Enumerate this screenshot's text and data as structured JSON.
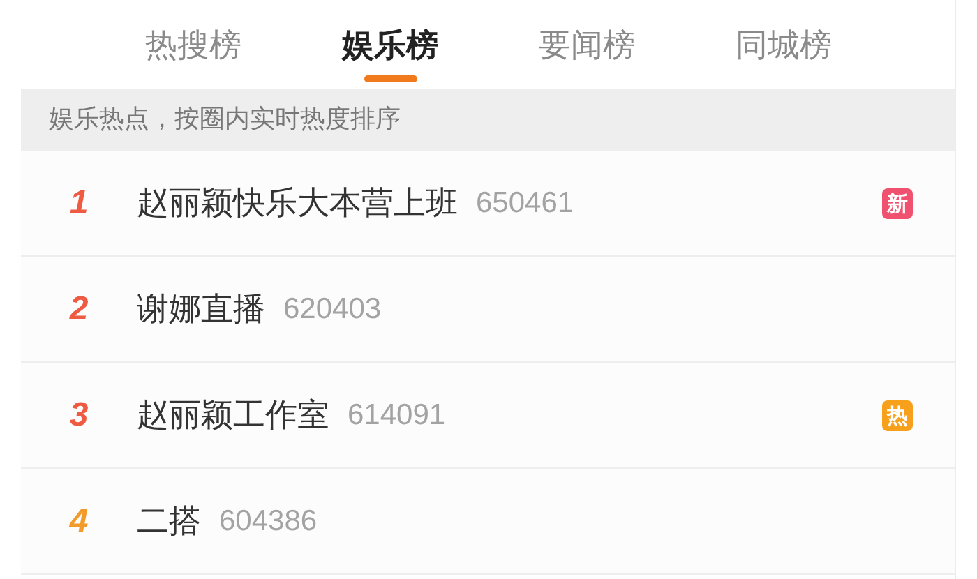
{
  "tabs": [
    {
      "label": "热搜榜",
      "selected": false
    },
    {
      "label": "娱乐榜",
      "selected": true
    },
    {
      "label": "要闻榜",
      "selected": false
    },
    {
      "label": "同城榜",
      "selected": false
    }
  ],
  "notice": "娱乐热点，按圈内实时热度排序",
  "rows": [
    {
      "rank": "1",
      "top": true,
      "title": "赵丽颖快乐大本营上班",
      "count": "650461",
      "badge": {
        "text": "新",
        "color": "#f0516f"
      }
    },
    {
      "rank": "2",
      "top": true,
      "title": "谢娜直播",
      "count": "620403"
    },
    {
      "rank": "3",
      "top": true,
      "title": "赵丽颖工作室",
      "count": "614091",
      "badge": {
        "text": "热",
        "color": "#f7a01c"
      }
    },
    {
      "rank": "4",
      "top": false,
      "title": "二搭",
      "count": "604386"
    }
  ]
}
